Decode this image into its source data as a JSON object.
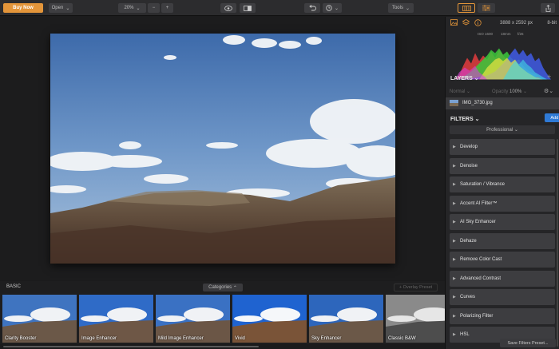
{
  "toolbar": {
    "buy_label": "Buy Now",
    "open_label": "Open",
    "zoom_value": "20%",
    "zoom_minus": "−",
    "zoom_plus": "+",
    "tools_label": "Tools",
    "icons": [
      "eye-icon",
      "compare-icon",
      "undo-icon",
      "history-icon",
      "filters-panel-icon",
      "sliders-icon",
      "share-icon"
    ],
    "accent_color": "#e3953a"
  },
  "image_info": {
    "dimensions": "3888 x 2592 px",
    "bit_depth": "8-bit",
    "iso": "ISO 1600",
    "focal": "18mm",
    "fnumber": "f/26"
  },
  "layers": {
    "title": "LAYERS",
    "blend_mode": "Normal",
    "opacity_label": "Opacity",
    "opacity_value": "100%",
    "items": [
      {
        "name": "IMG_3730.jpg"
      }
    ]
  },
  "filters": {
    "title": "FILTERS",
    "add_label": "Add Filters",
    "profile": "Professional",
    "items": [
      {
        "label": "Develop"
      },
      {
        "label": "Denoise"
      },
      {
        "label": "Saturation / Vibrance"
      },
      {
        "label": "Accent AI Filter™"
      },
      {
        "label": "AI Sky Enhancer"
      },
      {
        "label": "Dehaze"
      },
      {
        "label": "Remove Color Cast"
      },
      {
        "label": "Advanced Contrast"
      },
      {
        "label": "Curves"
      },
      {
        "label": "Polarizing Filter"
      },
      {
        "label": "HSL"
      }
    ],
    "save_label": "Save Filters Preset..."
  },
  "presets": {
    "group_label": "BASIC",
    "categories_label": "Categories",
    "overlay_label": "+ Overlay Preset",
    "items": [
      {
        "label": "Clarity Booster"
      },
      {
        "label": "Image Enhancer"
      },
      {
        "label": "Mild Image Enhancer"
      },
      {
        "label": "Vivid"
      },
      {
        "label": "Sky Enhancer"
      },
      {
        "label": "Classic B&W"
      }
    ]
  }
}
